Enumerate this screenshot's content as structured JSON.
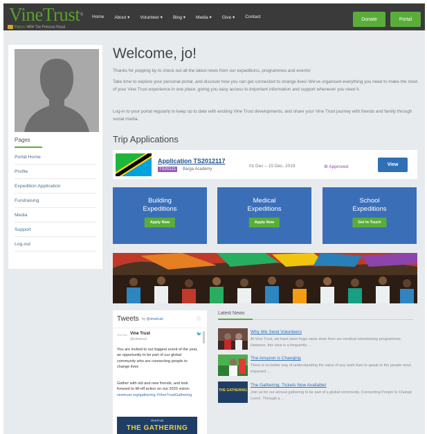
{
  "header": {
    "logo": "VineTrust",
    "logo_mark": "®",
    "patron_prefix": "Patron:",
    "patron_name": "HRH The Princess Royal",
    "nav": [
      "Home",
      "About ▾",
      "Volunteer ▾",
      "Blog ▾",
      "Media ▾",
      "Give ▾",
      "Contact"
    ],
    "donate": "Donate",
    "portal": "Portal"
  },
  "sidebar": {
    "pages_title": "Pages",
    "items": [
      "Portal Home",
      "Profile",
      "Expedition Application",
      "Fundraising",
      "Media",
      "Support",
      "Log-out"
    ]
  },
  "main": {
    "welcome": "Welcome, jo!",
    "p1": "Thanks for popping by to check out all the latest news from our expeditions, programmes and events!",
    "p2": "Take time to explore your personal portal, and discover how you can get connected to change lives! We've organised everything you need to make the most of your Vine Trust experience in one place, giving you easy access to important information and support whenever you need it.",
    "p3": "Log-in to your portal regularly to keep up to date with exciting Vine Trust developments, and share your Vine Trust journey with friends and family through social media.",
    "trip_title": "Trip Applications",
    "application": {
      "link": "Application TS2012117",
      "code": "TS20121",
      "school": "Barga Academy",
      "dates": "01 Dec – 15 Dec, 2019",
      "status": "⚙ Approved",
      "view": "View"
    },
    "expeditions": [
      {
        "line1": "Building",
        "line2": "Expeditions",
        "button": "Apply Now"
      },
      {
        "line1": "Medical",
        "line2": "Expeditions",
        "button": "Apply Now"
      },
      {
        "line1": "School",
        "line2": "Expeditions",
        "button": "Get In Touch"
      }
    ]
  },
  "tweets": {
    "title": "Tweets",
    "by": "by",
    "handle_link": "@vinetrust",
    "info": "ⓘ",
    "avatar_text": "VineTrust",
    "name": "Vine Trust",
    "handle": "@vinetrust",
    "bird": "🐦",
    "text1": "You are invited to our biggest event of the year, an opportunity to be part of our global community who are connecting people to change lives",
    "text2_main": "Gather with old and new friends, and look forward to lift-off action on our 2020 vision:",
    "text2_tags": "vinetrust.org/gathering #VineTrustGathering",
    "gathering_small": "VineTrust",
    "gathering_big": "THE GATHERING"
  },
  "news": {
    "title": "Latest News",
    "items": [
      {
        "headline": "Why We Send Volunteers",
        "excerpt": "At Vine Trust, we have seen huge value arise from our medical volunteering programmes. However, this view is a frequently ..."
      },
      {
        "headline": "The Amazon is Changing",
        "excerpt": "There is no better way of understanding the value of any work than to speak to the people most impacted ..."
      },
      {
        "headline": "The Gathering: Tickets Now Available!",
        "excerpt": "Join us for our annual gathering to be part of a global community. Connecting People to Change Lives!. Through a ..."
      }
    ],
    "thumb3_label": "THE GATHERING"
  },
  "colors": {
    "accent_green": "#5aad3a",
    "brand_blue": "#3a6fb8",
    "nav_bg": "#3a3a3a",
    "status_purple": "#8e44ad"
  }
}
